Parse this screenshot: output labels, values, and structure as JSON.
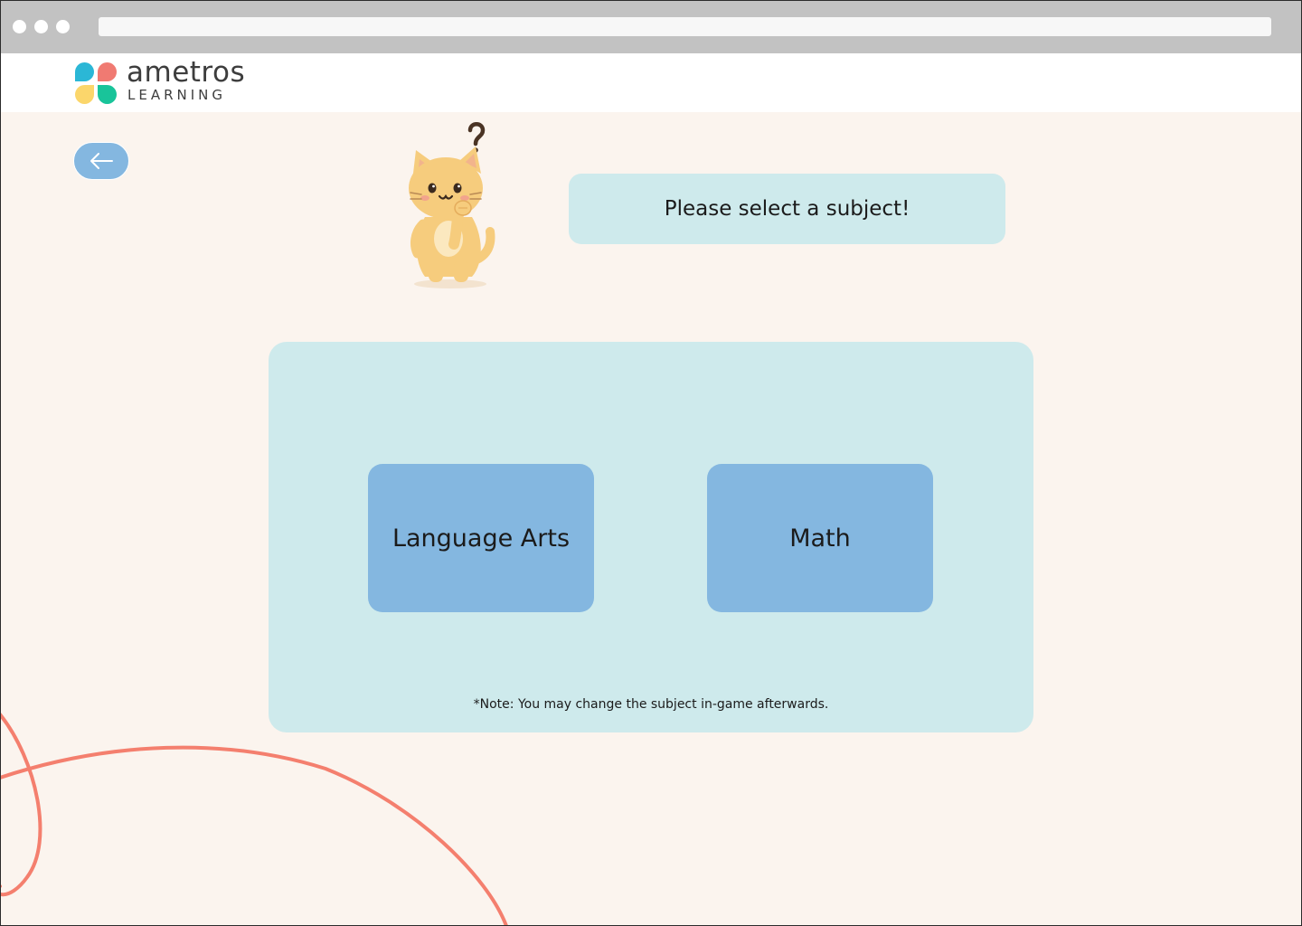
{
  "brand": {
    "name_top": "ametros",
    "name_bottom": "LEARNING",
    "colors": {
      "teal_blue": "#2bb7d6",
      "coral": "#f07a72",
      "yellow": "#fbd66b",
      "green": "#19c49a"
    }
  },
  "nav": {
    "back_icon": "arrow-left-icon"
  },
  "prompt": {
    "text": "Please select a subject!"
  },
  "subjects": {
    "items": [
      {
        "label": "Language Arts"
      },
      {
        "label": "Math"
      }
    ],
    "note": "*Note: You may change the subject in-game afterwards."
  },
  "colors": {
    "background": "#fbf4ee",
    "panel": "#ceeaec",
    "button": "#84b7e0",
    "accent_line": "#f47f6e"
  }
}
